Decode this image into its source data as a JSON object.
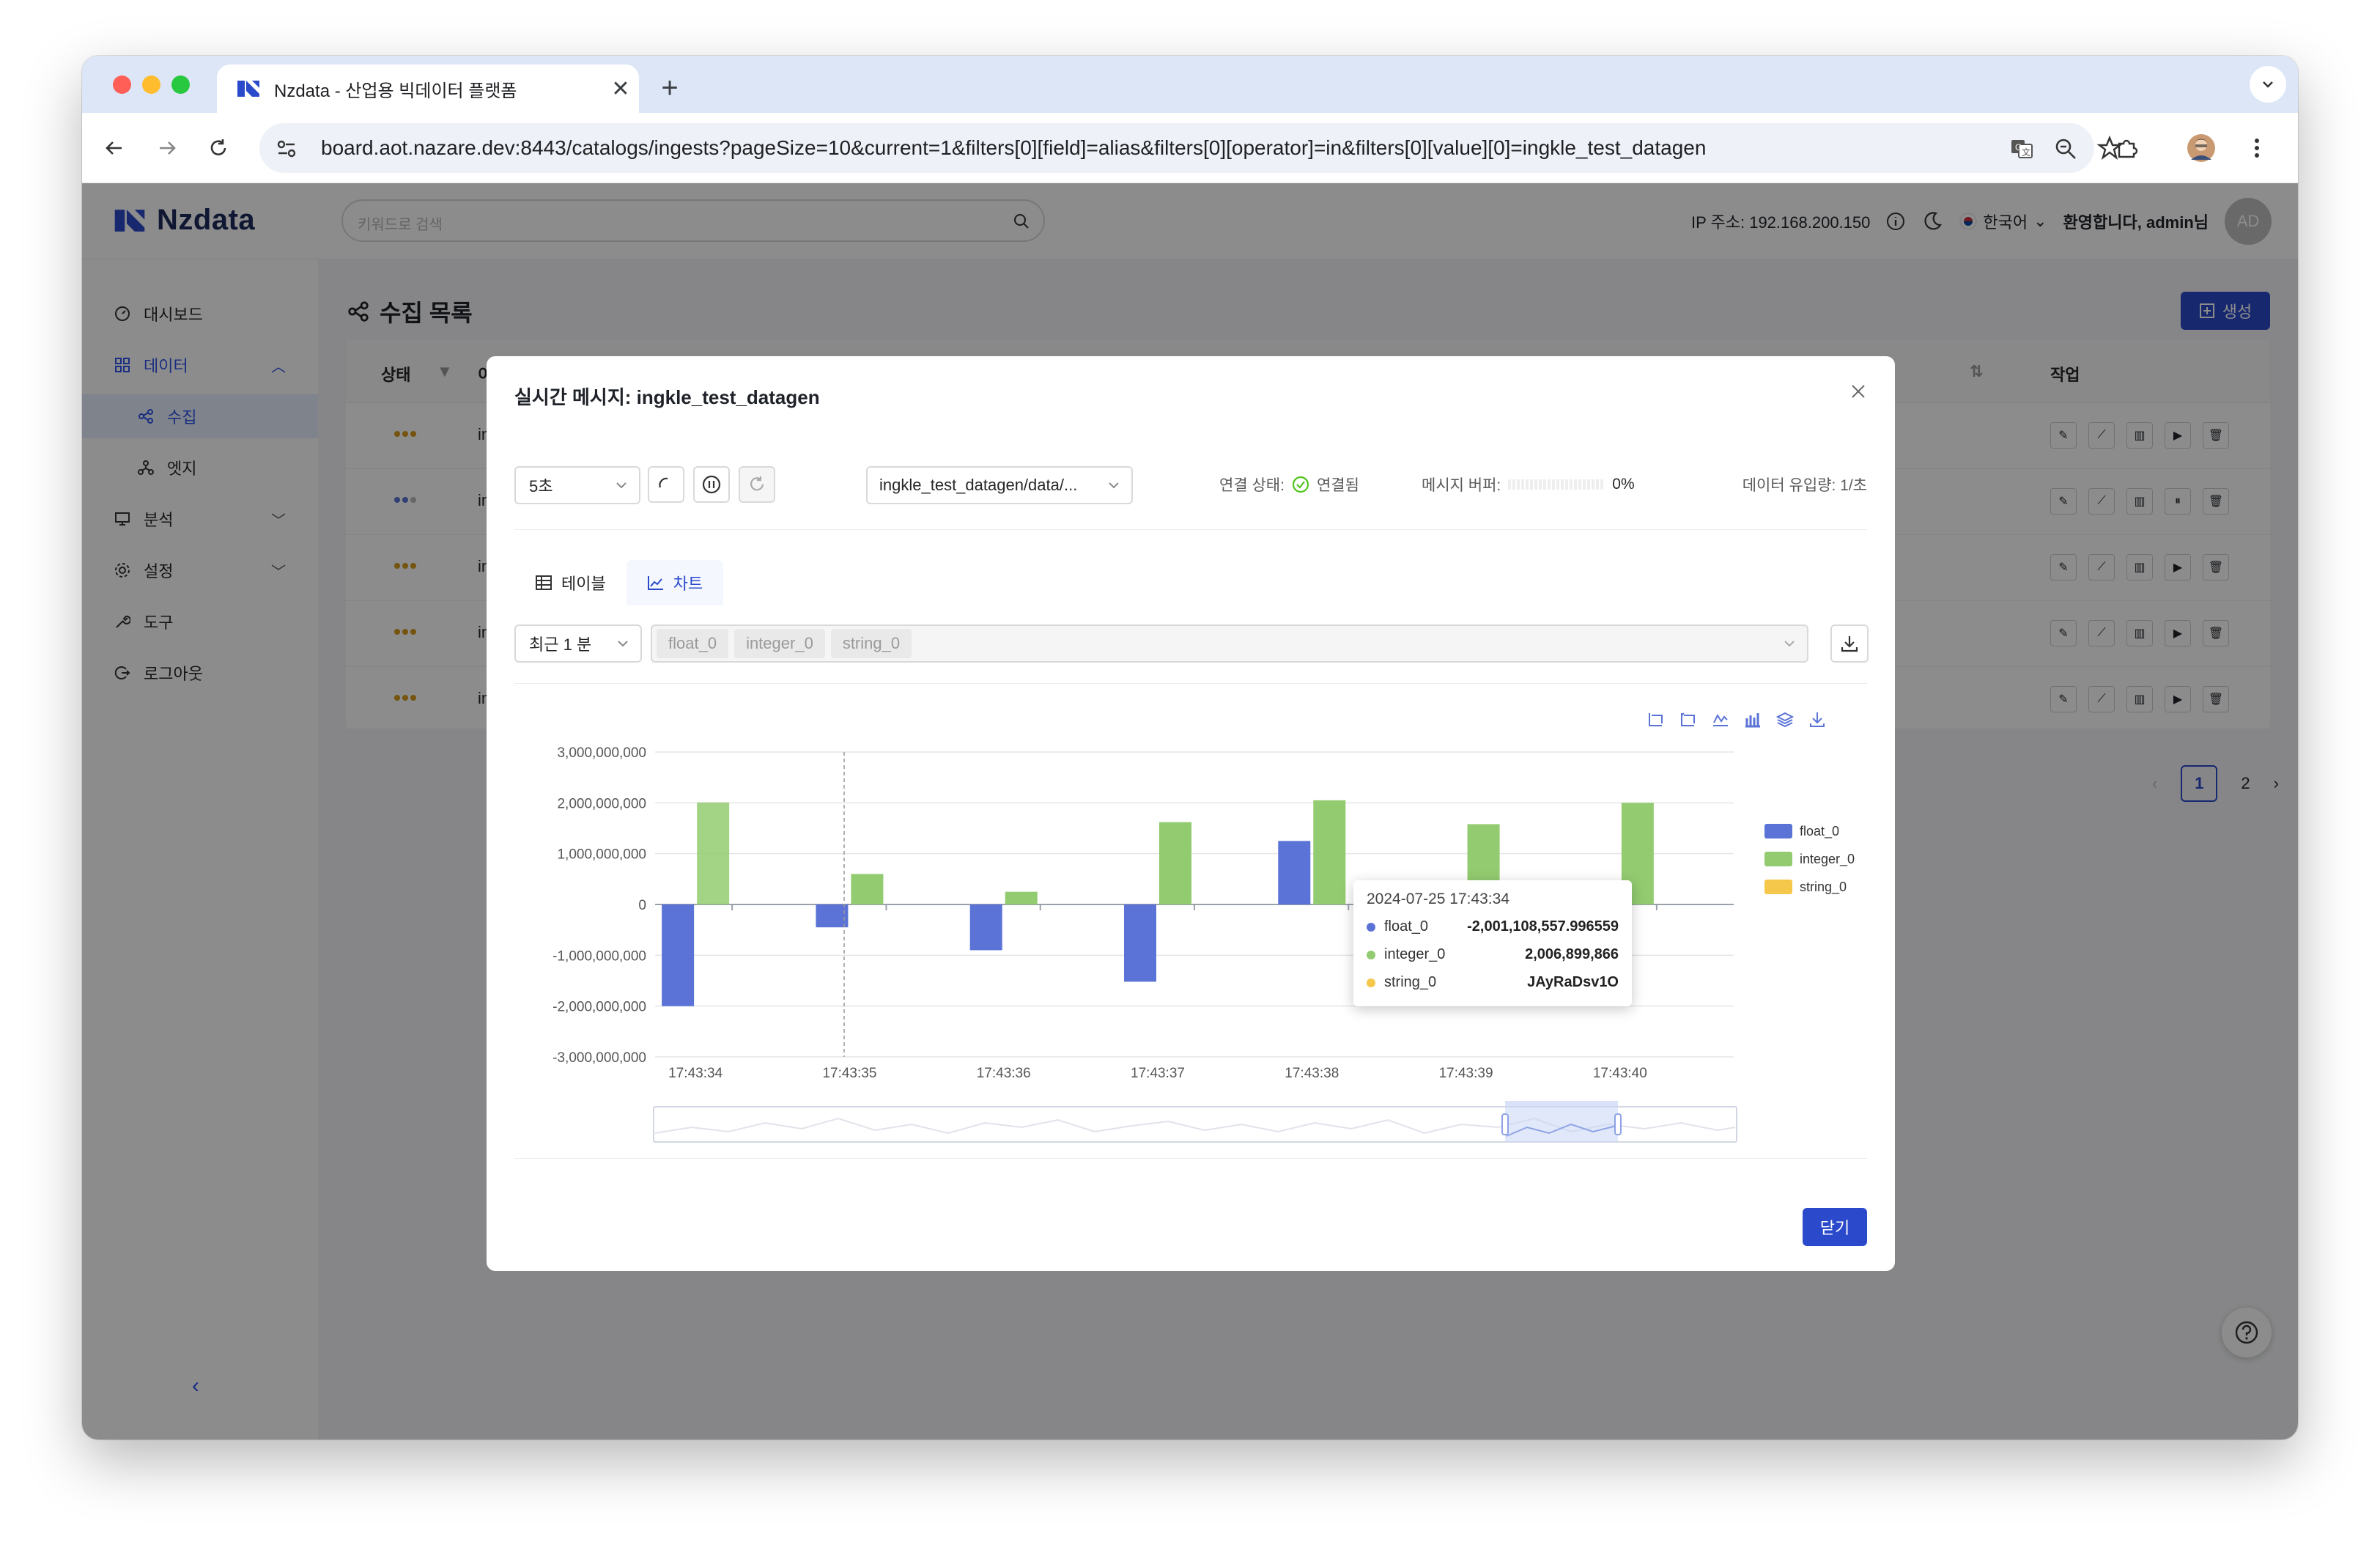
{
  "browser": {
    "tab_title": "Nzdata - 산업용 빅데이터 플랫폼",
    "url": "board.aot.nazare.dev:8443/catalogs/ingests?pageSize=10&current=1&filters[0][field]=alias&filters[0][operator]=in&filters[0][value][0]=ingkle_test_datagen"
  },
  "header": {
    "logo_text": "Nzdata",
    "search_placeholder": "키워드로 검색",
    "ip_label": "IP 주소: 192.168.200.150",
    "language": "한국어",
    "welcome": "환영합니다, admin님",
    "avatar": "AD"
  },
  "sidebar": {
    "items": [
      {
        "label": "대시보드"
      },
      {
        "label": "데이터"
      },
      {
        "label": "수집"
      },
      {
        "label": "엣지"
      },
      {
        "label": "분석"
      },
      {
        "label": "설정"
      },
      {
        "label": "도구"
      },
      {
        "label": "로그아웃"
      }
    ]
  },
  "page": {
    "title": "수집 목록",
    "create_label": "생성",
    "columns": {
      "status": "상태",
      "name": "이",
      "actions": "작업"
    },
    "rows": [
      {
        "name": "in"
      },
      {
        "name": "in"
      },
      {
        "name": "in"
      },
      {
        "name": "in"
      },
      {
        "name": "in"
      }
    ],
    "pagination": {
      "current": "1",
      "next": "2"
    }
  },
  "modal": {
    "title": "실시간 메시지: ingkle_test_datagen",
    "interval": "5초",
    "topic": "ingkle_test_datagen/data/...",
    "connection_label": "연결 상태:",
    "connection_value": "연결됨",
    "buffer_label": "메시지 버퍼:",
    "buffer_value": "0%",
    "rate_label": "데이터 유입량: 1/초",
    "tabs": {
      "table": "테이블",
      "chart": "차트"
    },
    "range": "최근 1 분",
    "fields": [
      "float_0",
      "integer_0",
      "string_0"
    ],
    "close_label": "닫기"
  },
  "chart_data": {
    "type": "bar",
    "categories": [
      "17:43:34",
      "17:43:35",
      "17:43:36",
      "17:43:37",
      "17:43:38",
      "17:43:39",
      "17:43:40"
    ],
    "yticks": [
      "3,000,000,000",
      "2,000,000,000",
      "1,000,000,000",
      "0",
      "-1,000,000,000",
      "-2,000,000,000",
      "-3,000,000,000"
    ],
    "ylim": [
      -3000000000,
      3000000000
    ],
    "series": [
      {
        "name": "float_0",
        "color": "#5b73d6",
        "values": [
          -2001108557.996559,
          -450000000,
          -900000000,
          -1520000000,
          1250000000,
          -2000000000,
          null
        ]
      },
      {
        "name": "integer_0",
        "color": "#93cb70",
        "values": [
          2006899866,
          600000000,
          250000000,
          1620000000,
          2050000000,
          1580000000,
          2000000000
        ]
      },
      {
        "name": "string_0",
        "color": "#f5c84c",
        "values": [
          null,
          null,
          null,
          null,
          null,
          null,
          null
        ]
      }
    ],
    "tooltip": {
      "title": "2024-07-25 17:43:34",
      "rows": [
        {
          "name": "float_0",
          "value": "-2,001,108,557.996559",
          "color": "#5b73d6"
        },
        {
          "name": "integer_0",
          "value": "2,006,899,866",
          "color": "#93cb70"
        },
        {
          "name": "string_0",
          "value": "JAyRaDsv1O",
          "color": "#f5c84c"
        }
      ]
    },
    "legend_position": "right",
    "grid": true
  }
}
